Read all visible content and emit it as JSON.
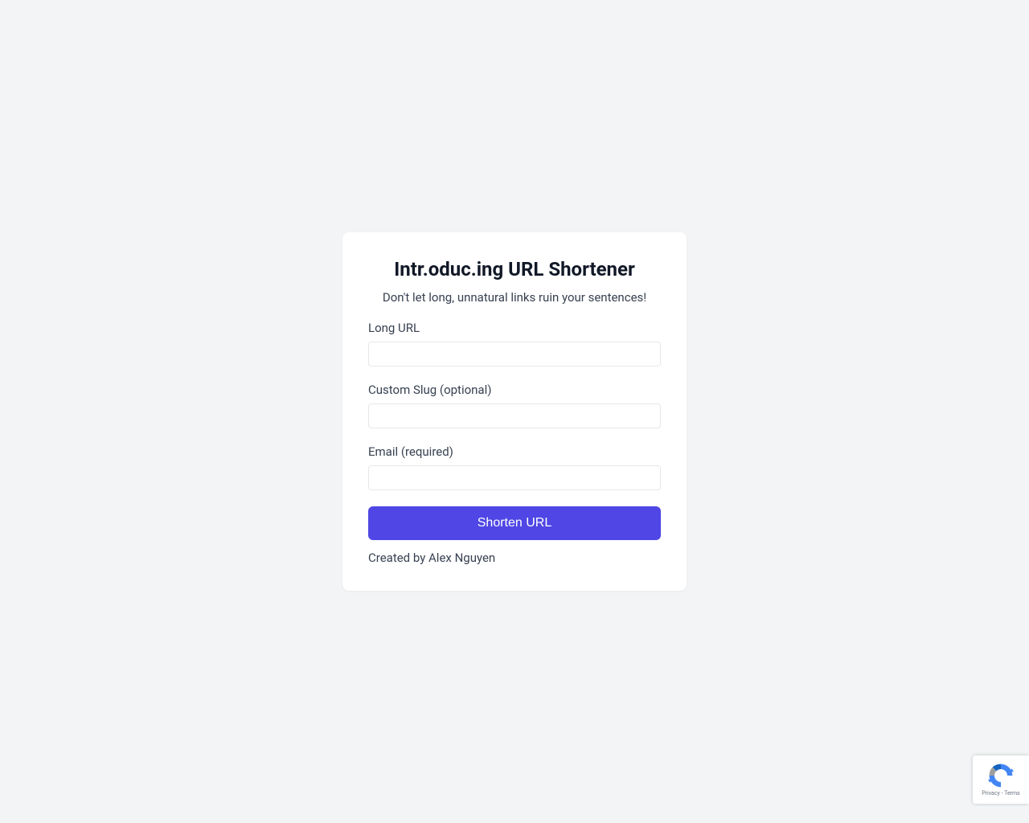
{
  "header": {
    "title": "Intr.oduc.ing URL Shortener",
    "subtitle": "Don't let long, unnatural links ruin your sentences!"
  },
  "form": {
    "long_url": {
      "label": "Long URL",
      "value": ""
    },
    "custom_slug": {
      "label": "Custom Slug (optional)",
      "value": ""
    },
    "email": {
      "label": "Email (required)",
      "value": ""
    },
    "submit_label": "Shorten URL"
  },
  "footer": {
    "creator_text": "Created by Alex Nguyen"
  },
  "recaptcha": {
    "privacy_text": "Privacy",
    "terms_text": "Terms"
  }
}
